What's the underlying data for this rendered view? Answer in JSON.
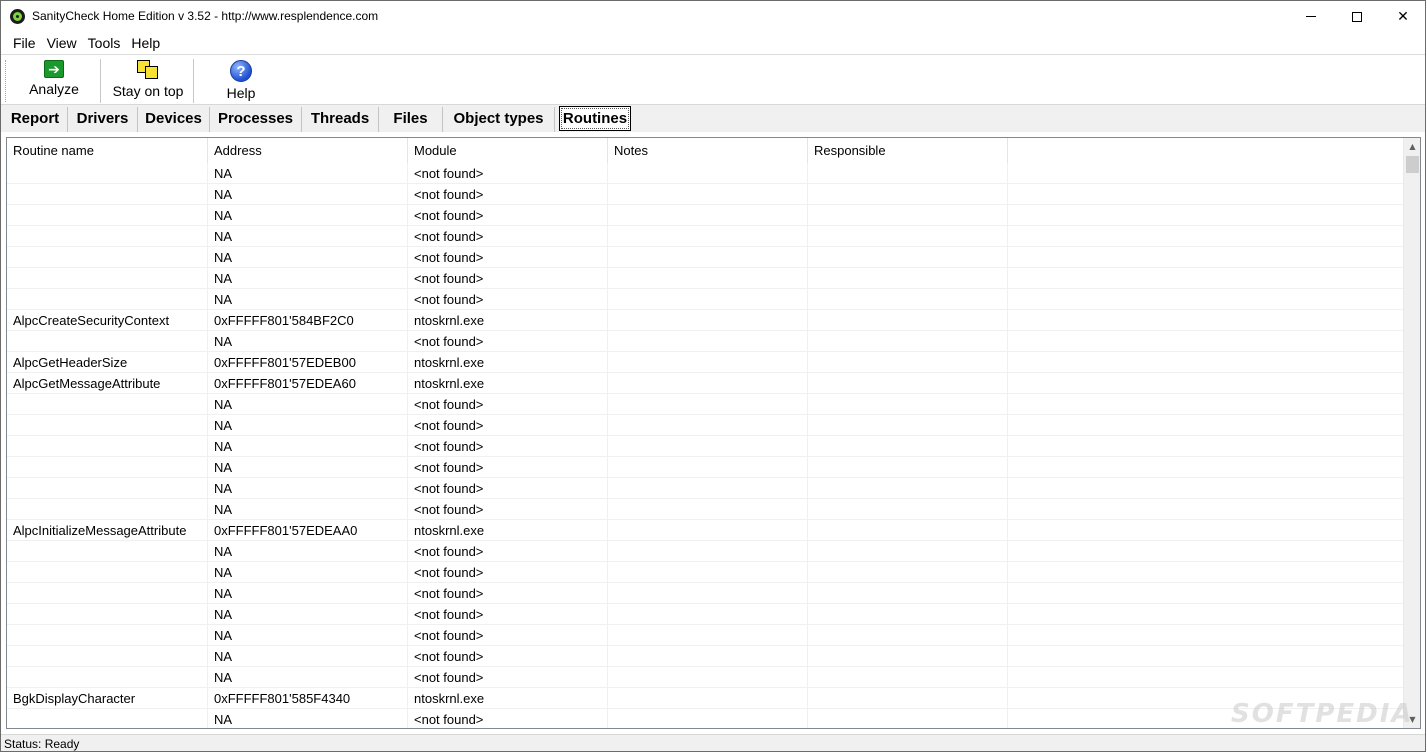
{
  "window": {
    "title": "SanityCheck Home Edition  v 3.52   -   http://www.resplendence.com",
    "minimize_glyph": "—",
    "maximize_glyph": "☐",
    "close_glyph": "✕"
  },
  "menu": [
    "File",
    "View",
    "Tools",
    "Help"
  ],
  "toolbar": {
    "analyze_label": "Analyze",
    "analyze_icon": "analyze-arrow-icon",
    "stay_on_top_label": "Stay on top",
    "stay_on_top_icon": "windows-stack-icon",
    "help_label": "Help",
    "help_icon": "help-question-icon"
  },
  "tabs": [
    "Report",
    "Drivers",
    "Devices",
    "Processes",
    "Threads",
    "Files",
    "Object types",
    "Routines"
  ],
  "active_tab": "Routines",
  "table": {
    "columns": [
      "Routine name",
      "Address",
      "Module",
      "Notes",
      "Responsible"
    ],
    "rows": [
      [
        "",
        "NA",
        "<not found>",
        "",
        ""
      ],
      [
        "",
        "NA",
        "<not found>",
        "",
        ""
      ],
      [
        "",
        "NA",
        "<not found>",
        "",
        ""
      ],
      [
        "",
        "NA",
        "<not found>",
        "",
        ""
      ],
      [
        "",
        "NA",
        "<not found>",
        "",
        ""
      ],
      [
        "",
        "NA",
        "<not found>",
        "",
        ""
      ],
      [
        "",
        "NA",
        "<not found>",
        "",
        ""
      ],
      [
        "AlpcCreateSecurityContext",
        "0xFFFFF801'584BF2C0",
        "ntoskrnl.exe",
        "",
        ""
      ],
      [
        "",
        "NA",
        "<not found>",
        "",
        ""
      ],
      [
        "AlpcGetHeaderSize",
        "0xFFFFF801'57EDEB00",
        "ntoskrnl.exe",
        "",
        ""
      ],
      [
        "AlpcGetMessageAttribute",
        "0xFFFFF801'57EDEA60",
        "ntoskrnl.exe",
        "",
        ""
      ],
      [
        "",
        "NA",
        "<not found>",
        "",
        ""
      ],
      [
        "",
        "NA",
        "<not found>",
        "",
        ""
      ],
      [
        "",
        "NA",
        "<not found>",
        "",
        ""
      ],
      [
        "",
        "NA",
        "<not found>",
        "",
        ""
      ],
      [
        "",
        "NA",
        "<not found>",
        "",
        ""
      ],
      [
        "",
        "NA",
        "<not found>",
        "",
        ""
      ],
      [
        "AlpcInitializeMessageAttribute",
        "0xFFFFF801'57EDEAA0",
        "ntoskrnl.exe",
        "",
        ""
      ],
      [
        "",
        "NA",
        "<not found>",
        "",
        ""
      ],
      [
        "",
        "NA",
        "<not found>",
        "",
        ""
      ],
      [
        "",
        "NA",
        "<not found>",
        "",
        ""
      ],
      [
        "",
        "NA",
        "<not found>",
        "",
        ""
      ],
      [
        "",
        "NA",
        "<not found>",
        "",
        ""
      ],
      [
        "",
        "NA",
        "<not found>",
        "",
        ""
      ],
      [
        "",
        "NA",
        "<not found>",
        "",
        ""
      ],
      [
        "BgkDisplayCharacter",
        "0xFFFFF801'585F4340",
        "ntoskrnl.exe",
        "",
        ""
      ],
      [
        "",
        "NA",
        "<not found>",
        "",
        ""
      ]
    ]
  },
  "scrollbar": {
    "up_glyph": "▲",
    "down_glyph": "▼"
  },
  "status": "Status: Ready",
  "watermark": "SOFTPEDIA"
}
